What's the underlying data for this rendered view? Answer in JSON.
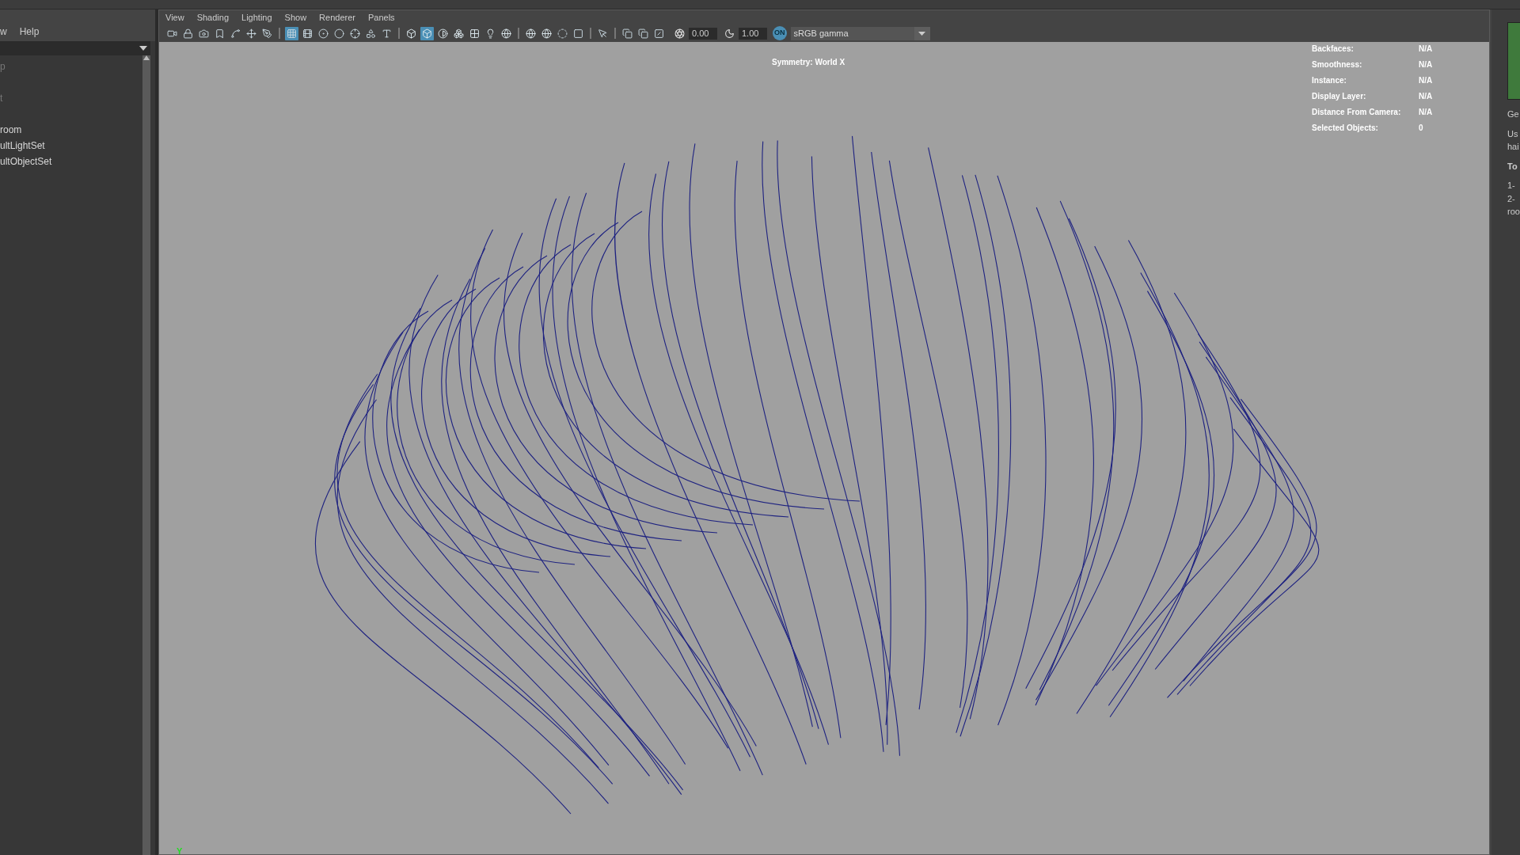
{
  "outliner": {
    "menu": [
      "w",
      "Help"
    ],
    "items": [
      {
        "label": "p",
        "dimmed": true
      },
      {
        "label": "t",
        "dimmed": true
      },
      {
        "label": "room",
        "dimmed": false
      },
      {
        "label": "ultLightSet",
        "dimmed": false
      },
      {
        "label": "ultObjectSet",
        "dimmed": false
      }
    ]
  },
  "viewport": {
    "menu": [
      "View",
      "Shading",
      "Lighting",
      "Show",
      "Renderer",
      "Panels"
    ],
    "toolbar": [
      {
        "selected": false
      },
      {
        "selected": false
      },
      {
        "selected": false
      },
      {
        "selected": false
      },
      {
        "selected": false
      },
      {
        "selected": false
      },
      {
        "selected": false
      },
      {
        "selected": true
      },
      {
        "selected": false
      },
      {
        "selected": false
      },
      {
        "selected": false
      },
      {
        "selected": false
      },
      {
        "selected": false
      },
      {
        "selected": false
      },
      {
        "selected": false
      },
      {
        "selected": true
      },
      {
        "selected": false
      },
      {
        "selected": false
      },
      {
        "selected": false
      },
      {
        "selected": false
      },
      {
        "selected": false
      },
      {
        "selected": false
      },
      {
        "selected": false
      },
      {
        "selected": false
      },
      {
        "selected": false
      },
      {
        "selected": false
      },
      {
        "selected": false
      },
      {
        "selected": false
      },
      {
        "selected": false
      }
    ],
    "exposure": "0.00",
    "gamma": "1.00",
    "color_management": {
      "label": "ON",
      "on": true
    },
    "view_transform": "sRGB gamma",
    "symmetry": "Symmetry: World X",
    "hud": [
      {
        "label": "Backfaces:",
        "value": "N/A"
      },
      {
        "label": "Smoothness:",
        "value": "N/A"
      },
      {
        "label": "Instance:",
        "value": "N/A"
      },
      {
        "label": "Display Layer:",
        "value": "N/A"
      },
      {
        "label": "Distance From Camera:",
        "value": "N/A"
      },
      {
        "label": "Selected Objects:",
        "value": "0"
      }
    ],
    "axis_label": "Y"
  },
  "side_panel": {
    "texts": [
      "Ge",
      "Us",
      "hai",
      "To",
      "1-",
      "2-",
      "roo"
    ]
  }
}
